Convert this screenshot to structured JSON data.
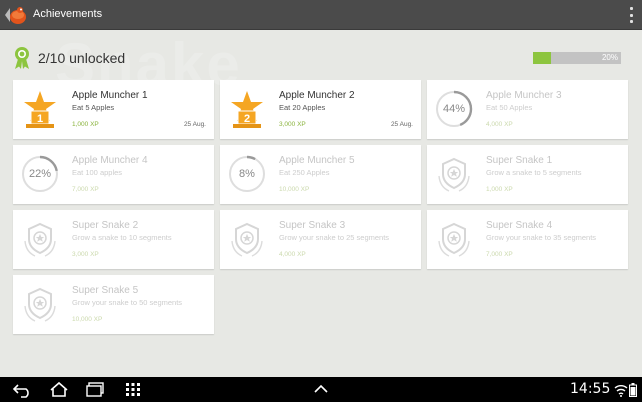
{
  "app": {
    "title": "Achievements"
  },
  "background_watermark": "Snake",
  "summary": {
    "label": "2/10 unlocked",
    "progress_fraction": 0.2,
    "progress_label": "20%"
  },
  "achievements": [
    {
      "title": "Apple Muncher 1",
      "desc": "Eat 5 Apples",
      "xp": "1,000 XP",
      "date": "25 Aug.",
      "state": "unlocked",
      "badge": "1"
    },
    {
      "title": "Apple Muncher 2",
      "desc": "Eat 20 Apples",
      "xp": "3,000 XP",
      "date": "25 Aug.",
      "state": "unlocked",
      "badge": "2"
    },
    {
      "title": "Apple Muncher 3",
      "desc": "Eat 50 Apples",
      "xp": "4,000 XP",
      "state": "progress",
      "percent": "44%",
      "fraction": 0.44
    },
    {
      "title": "Apple Muncher 4",
      "desc": "Eat 100 apples",
      "xp": "7,000 XP",
      "state": "progress",
      "percent": "22%",
      "fraction": 0.22
    },
    {
      "title": "Apple Muncher 5",
      "desc": "Eat 250 Apples",
      "xp": "10,000 XP",
      "state": "progress",
      "percent": "8%",
      "fraction": 0.08
    },
    {
      "title": "Super Snake 1",
      "desc": "Grow a snake to 5 segments",
      "xp": "1,000 XP",
      "state": "locked"
    },
    {
      "title": "Super Snake 2",
      "desc": "Grow a snake to 10 segments",
      "xp": "3,000 XP",
      "state": "locked"
    },
    {
      "title": "Super Snake 3",
      "desc": "Grow your snake to 25 segments",
      "xp": "4,000 XP",
      "state": "locked"
    },
    {
      "title": "Super Snake 4",
      "desc": "Grow your snake to 35 segments",
      "xp": "7,000 XP",
      "state": "locked"
    },
    {
      "title": "Super Snake 5",
      "desc": "Grow your snake to 50 segments",
      "xp": "10,000 XP",
      "state": "locked"
    }
  ],
  "status_bar": {
    "time": "14:55"
  },
  "colors": {
    "accent_green": "#8dc53f",
    "badge_orange": "#f5a623",
    "actionbar": "#4b4b4b"
  },
  "icons": [
    "app-logo-icon",
    "overflow-menu-icon",
    "award-ribbon-icon",
    "trophy-star-icon",
    "locked-shield-icon",
    "back-icon",
    "home-icon",
    "recent-apps-icon",
    "screenshot-icon",
    "up-chevron-icon",
    "wifi-icon",
    "battery-icon"
  ]
}
